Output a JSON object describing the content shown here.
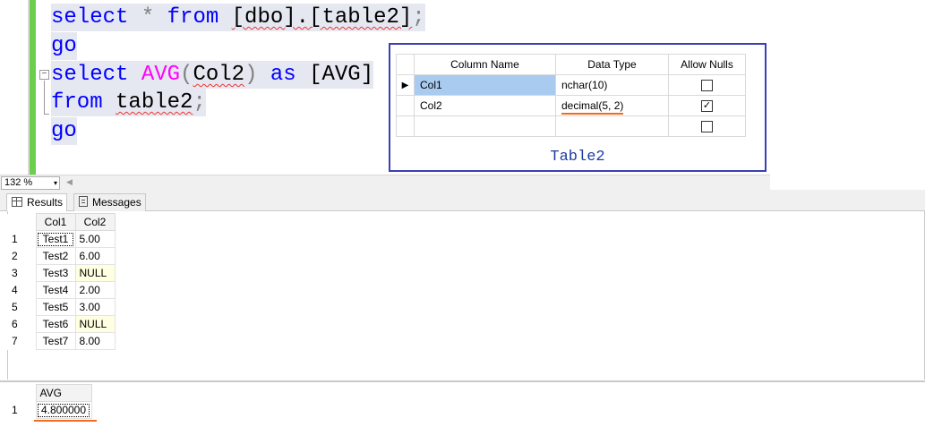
{
  "editor": {
    "line1": {
      "select": "select",
      "star": "*",
      "from": "from",
      "ref": "[dbo].[table2]",
      "semi": ";"
    },
    "line2": {
      "go": "go"
    },
    "line3": {
      "select": "select",
      "fn": "AVG",
      "open": "(",
      "col": "Col2",
      "close": ")",
      "as": "as",
      "alias": "[AVG]"
    },
    "line4": {
      "from": "from",
      "tbl": "table2",
      "semi": ";"
    },
    "line5": {
      "go": "go"
    },
    "collapse_symbol": "−"
  },
  "designer": {
    "headers": [
      "Column Name",
      "Data Type",
      "Allow Nulls"
    ],
    "rows": [
      {
        "name": "Col1",
        "type": "nchar(10)",
        "allow_nulls": false
      },
      {
        "name": "Col2",
        "type": "decimal(5, 2)",
        "allow_nulls": true
      },
      {
        "name": "",
        "type": "",
        "allow_nulls": false
      }
    ],
    "caption": "Table2",
    "row_marker": "▶"
  },
  "zoom": {
    "value": "132 %",
    "dropdown": "▾",
    "scroll_left": "◀"
  },
  "tabs": [
    {
      "label": "Results",
      "icon": "grid-icon"
    },
    {
      "label": "Messages",
      "icon": "messages-icon"
    }
  ],
  "results": {
    "headers": [
      "Col1",
      "Col2"
    ],
    "rows": [
      {
        "n": "1",
        "col1": "Test1",
        "col2": "5.00"
      },
      {
        "n": "2",
        "col1": "Test2",
        "col2": "6.00"
      },
      {
        "n": "3",
        "col1": "Test3",
        "col2": "NULL"
      },
      {
        "n": "4",
        "col1": "Test4",
        "col2": "2.00"
      },
      {
        "n": "5",
        "col1": "Test5",
        "col2": "3.00"
      },
      {
        "n": "6",
        "col1": "Test6",
        "col2": "NULL"
      },
      {
        "n": "7",
        "col1": "Test7",
        "col2": "8.00"
      }
    ]
  },
  "avg_result": {
    "header": "AVG",
    "row_number": "1",
    "value": "4.800000"
  },
  "colors": {
    "keyword": "#0000ff",
    "function": "#ff00ff",
    "change_bar": "#6ccf4b",
    "designer_border": "#3b3fb3",
    "annotation": "#f26b1d"
  }
}
